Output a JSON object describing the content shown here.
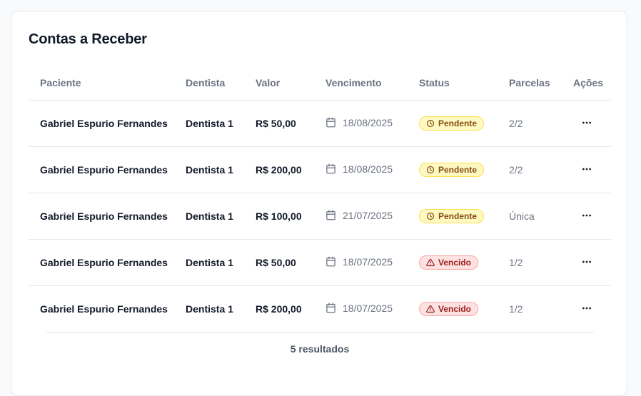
{
  "page": {
    "title": "Contas a Receber",
    "results_text": "5 resultados"
  },
  "table": {
    "headers": {
      "paciente": "Paciente",
      "dentista": "Dentista",
      "valor": "Valor",
      "vencimento": "Vencimento",
      "status": "Status",
      "parcelas": "Parcelas",
      "acoes": "Ações"
    },
    "rows": [
      {
        "paciente": "Gabriel Espurio Fernandes",
        "dentista": "Dentista 1",
        "valor": "R$ 50,00",
        "vencimento": "18/08/2025",
        "status": "Pendente",
        "status_kind": "pendente",
        "parcelas": "2/2"
      },
      {
        "paciente": "Gabriel Espurio Fernandes",
        "dentista": "Dentista 1",
        "valor": "R$ 200,00",
        "vencimento": "18/08/2025",
        "status": "Pendente",
        "status_kind": "pendente",
        "parcelas": "2/2"
      },
      {
        "paciente": "Gabriel Espurio Fernandes",
        "dentista": "Dentista 1",
        "valor": "R$ 100,00",
        "vencimento": "21/07/2025",
        "status": "Pendente",
        "status_kind": "pendente",
        "parcelas": "Única"
      },
      {
        "paciente": "Gabriel Espurio Fernandes",
        "dentista": "Dentista 1",
        "valor": "R$ 50,00",
        "vencimento": "18/07/2025",
        "status": "Vencido",
        "status_kind": "vencido",
        "parcelas": "1/2"
      },
      {
        "paciente": "Gabriel Espurio Fernandes",
        "dentista": "Dentista 1",
        "valor": "R$ 200,00",
        "vencimento": "18/07/2025",
        "status": "Vencido",
        "status_kind": "vencido",
        "parcelas": "1/2"
      }
    ]
  },
  "icons": {
    "date": "calendar-icon",
    "pendente": "clock-icon",
    "vencido": "alert-triangle-icon",
    "actions": "more-horizontal-icon"
  },
  "colors": {
    "pendente_bg": "#fef9c3",
    "pendente_text": "#854d0e",
    "vencido_bg": "#fee2e2",
    "vencido_text": "#991b1b",
    "text_primary": "#111827",
    "text_muted": "#6b7280"
  }
}
